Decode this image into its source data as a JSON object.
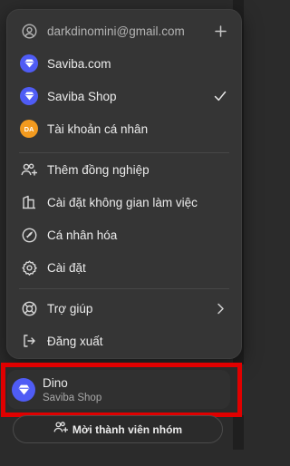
{
  "menu": {
    "account_email": "darkdinomini@gmail.com",
    "workspaces": [
      {
        "label": "Saviba.com",
        "icon": "brand-diamond-icon"
      },
      {
        "label": "Saviba Shop",
        "icon": "brand-diamond-icon",
        "selected": true
      },
      {
        "label": "Tài khoản cá nhân",
        "avatar_initials": "DA"
      }
    ],
    "items": [
      {
        "label": "Thêm đồng nghiệp",
        "icon": "add-people-icon"
      },
      {
        "label": "Cài đặt không gian làm việc",
        "icon": "workspace-building-icon"
      },
      {
        "label": "Cá nhân hóa",
        "icon": "personalize-icon"
      },
      {
        "label": "Cài đặt",
        "icon": "gear-icon"
      }
    ],
    "footer_items": [
      {
        "label": "Trợ giúp",
        "icon": "help-lifebuoy-icon"
      },
      {
        "label": "Đăng xuất",
        "icon": "logout-icon"
      }
    ]
  },
  "current_workspace": {
    "name": "Dino",
    "subtitle": "Saviba Shop"
  },
  "invite_button": {
    "label": "Mời thành viên nhóm"
  },
  "colors": {
    "brand": "#4f5cf5",
    "avatar_da": "#f29a1f",
    "highlight": "#e00000",
    "menu_bg": "#353535",
    "page_bg": "#2b2b2b"
  }
}
